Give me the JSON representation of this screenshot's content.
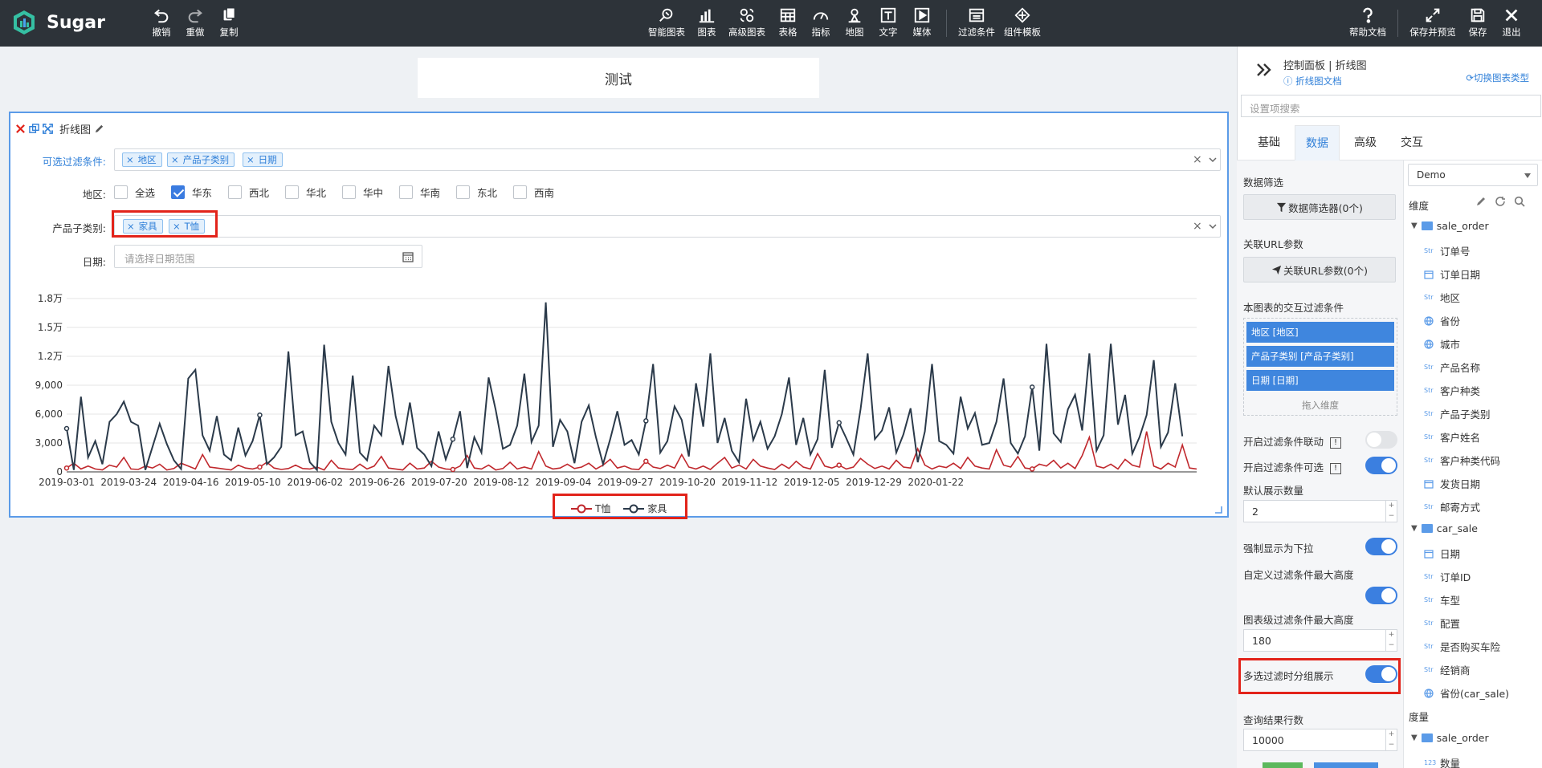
{
  "app": {
    "name": "Sugar"
  },
  "toolbar_left": [
    {
      "id": "undo",
      "label": "撤销",
      "icon": "undo-icon"
    },
    {
      "id": "redo",
      "label": "重做",
      "icon": "redo-icon"
    },
    {
      "id": "copy",
      "label": "复制",
      "icon": "copy-icon"
    }
  ],
  "toolbar_center": [
    {
      "id": "smart-chart",
      "label": "智能图表",
      "icon": "magic-icon"
    },
    {
      "id": "chart",
      "label": "图表",
      "icon": "bar-chart-icon"
    },
    {
      "id": "advanced-chart",
      "label": "高级图表",
      "icon": "advanced-chart-icon"
    },
    {
      "id": "table",
      "label": "表格",
      "icon": "table-icon"
    },
    {
      "id": "metric",
      "label": "指标",
      "icon": "gauge-icon"
    },
    {
      "id": "map",
      "label": "地图",
      "icon": "map-pin-icon"
    },
    {
      "id": "text",
      "label": "文字",
      "icon": "text-icon"
    },
    {
      "id": "media",
      "label": "媒体",
      "icon": "play-icon"
    },
    {
      "id": "filter",
      "label": "过滤条件",
      "icon": "filter-icon"
    },
    {
      "id": "template",
      "label": "组件模板",
      "icon": "template-icon"
    }
  ],
  "toolbar_right": [
    {
      "id": "help",
      "label": "帮助文档",
      "icon": "question-icon"
    },
    {
      "id": "save-preview",
      "label": "保存并预览",
      "icon": "expand-icon"
    },
    {
      "id": "save",
      "label": "保存",
      "icon": "save-icon"
    },
    {
      "id": "exit",
      "label": "退出",
      "icon": "close-icon"
    }
  ],
  "canvas": {
    "title": "测试"
  },
  "chart_card": {
    "title": "折线图",
    "optional_filters_label": "可选过滤条件:",
    "optional_filter_tags": [
      "地区",
      "产品子类别",
      "日期"
    ],
    "region_label": "地区:",
    "region_options": [
      {
        "label": "全选",
        "checked": false
      },
      {
        "label": "华东",
        "checked": true
      },
      {
        "label": "西北",
        "checked": false
      },
      {
        "label": "华北",
        "checked": false
      },
      {
        "label": "华中",
        "checked": false
      },
      {
        "label": "华南",
        "checked": false
      },
      {
        "label": "东北",
        "checked": false
      },
      {
        "label": "西南",
        "checked": false
      }
    ],
    "subcategory_label": "产品子类别:",
    "subcategory_tags": [
      "家具",
      "T恤"
    ],
    "date_label": "日期:",
    "date_placeholder": "请选择日期范围"
  },
  "chart_data": {
    "type": "line",
    "ylim": [
      0,
      18000
    ],
    "y_ticks": [
      0,
      3000,
      6000,
      9000,
      12000,
      15000,
      18000
    ],
    "y_tick_labels": [
      "0",
      "3,000",
      "6,000",
      "9,000",
      "1.2万",
      "1.5万",
      "1.8万"
    ],
    "x_tick_labels": [
      "2019-03-01",
      "2019-03-24",
      "2019-04-16",
      "2019-05-10",
      "2019-06-02",
      "2019-06-26",
      "2019-07-20",
      "2019-08-12",
      "2019-09-04",
      "2019-09-27",
      "2019-10-20",
      "2019-11-12",
      "2019-12-05",
      "2019-12-29",
      "2020-01-22"
    ],
    "grid": true,
    "legend_position": "bottom-center",
    "series": [
      {
        "name": "T恤",
        "color": "#c0282d",
        "values": [
          400,
          900,
          300,
          600,
          300,
          200,
          700,
          500,
          1500,
          300,
          250,
          600,
          400,
          800,
          200,
          350,
          900,
          600,
          300,
          1800,
          500,
          400,
          300,
          200,
          700,
          400,
          300,
          500,
          1000,
          400,
          250,
          350,
          700,
          350,
          300,
          500,
          200,
          1200,
          400,
          300,
          250,
          800,
          300,
          600,
          1600,
          400,
          300,
          200,
          900,
          300,
          400,
          1100,
          500,
          300,
          250,
          600,
          1700,
          400,
          300,
          700,
          200,
          350,
          1000,
          300,
          500,
          300,
          2100,
          600,
          300,
          400,
          800,
          350,
          500,
          900,
          300,
          700,
          1300,
          400,
          600,
          300,
          250,
          1100,
          500,
          350,
          700,
          400,
          1800,
          500,
          300,
          600,
          250,
          900,
          1500,
          400,
          700,
          300,
          1300,
          600,
          400,
          250,
          800,
          350,
          1100,
          500,
          300,
          1900,
          600,
          400,
          700,
          300,
          500,
          1400,
          800,
          350,
          600,
          300,
          1200,
          500,
          400,
          2400,
          700,
          300,
          600,
          450,
          900,
          350,
          1500,
          600,
          400,
          300,
          2300,
          700,
          500,
          1600,
          400,
          300,
          800,
          600,
          1200,
          400,
          900,
          350,
          1700,
          3600,
          600,
          400,
          800,
          300,
          1300,
          700,
          500,
          4200,
          600,
          300,
          900,
          500,
          2800,
          400,
          300
        ]
      },
      {
        "name": "家具",
        "color": "#2b3a4a",
        "values": [
          4500,
          200,
          7800,
          1500,
          3200,
          800,
          5200,
          6000,
          7300,
          5200,
          4800,
          200,
          2600,
          5000,
          2900,
          1200,
          300,
          9700,
          10600,
          3800,
          2200,
          5800,
          1800,
          1200,
          4600,
          1700,
          3200,
          5900,
          800,
          1500,
          2600,
          12500,
          3800,
          4200,
          1000,
          200,
          13200,
          5200,
          3000,
          1800,
          10000,
          2000,
          1200,
          4800,
          3800,
          11000,
          5800,
          2800,
          7200,
          2500,
          1800,
          600,
          4200,
          1300,
          3400,
          6300,
          400,
          3600,
          2000,
          9800,
          6400,
          2400,
          2800,
          4800,
          10200,
          3100,
          4800,
          17600,
          2600,
          5400,
          4200,
          900,
          5200,
          6900,
          3600,
          800,
          3400,
          6300,
          2800,
          3300,
          1800,
          5300,
          11200,
          2000,
          3200,
          6800,
          5400,
          1600,
          9200,
          4700,
          12300,
          3000,
          5600,
          2200,
          1000,
          7600,
          3300,
          5200,
          2400,
          3700,
          6000,
          9800,
          2800,
          5600,
          1800,
          3400,
          10600,
          2500,
          5100,
          3500,
          1800,
          6500,
          12300,
          3400,
          4300,
          6700,
          2000,
          3900,
          6600,
          1000,
          4200,
          11200,
          3200,
          2800,
          1900,
          7800,
          4500,
          6100,
          2800,
          3000,
          5200,
          9700,
          3000,
          1900,
          3700,
          8800,
          2200,
          13300,
          4000,
          3100,
          6500,
          8000,
          4300,
          12300,
          2200,
          3800,
          13300,
          4900,
          8000,
          1900,
          3600,
          5900,
          11600,
          2600,
          4100,
          9200,
          3700
        ]
      }
    ]
  },
  "panel": {
    "title": "控制面板 | 折线图",
    "doc_link": "折线图文档",
    "switch_link": "切换图表类型",
    "search_placeholder": "设置项搜索",
    "tabs": [
      "基础",
      "数据",
      "高级",
      "交互"
    ],
    "active_tab": "数据",
    "settings": {
      "data_filter_label": "数据筛选",
      "data_filter_button": "数据筛选器(0个)",
      "url_param_label": "关联URL参数",
      "url_param_button": "关联URL参数(0个)",
      "interactive_filters_label": "本图表的交互过滤条件",
      "interactive_filters": [
        "地区 [地区]",
        "产品子类别 [产品子类别]",
        "日期 [日期]"
      ],
      "drop_hint": "拖入维度",
      "filter_linkage_label": "开启过滤条件联动",
      "filter_optional_label": "开启过滤条件可选",
      "default_count_label": "默认展示数量",
      "default_count_value": "2",
      "force_dropdown_label": "强制显示为下拉",
      "custom_max_height_label": "自定义过滤条件最大高度",
      "chart_filter_max_height_label": "图表级过滤条件最大高度",
      "chart_filter_max_height_value": "180",
      "multi_group_label": "多选过滤时分组展示",
      "query_rows_label": "查询结果行数",
      "query_rows_value": "10000"
    },
    "fields": {
      "source": "Demo",
      "dimension_label": "维度",
      "measure_label": "度量",
      "sale_order_table": "sale_order",
      "sale_order_fields": [
        {
          "name": "订单号",
          "type": "str"
        },
        {
          "name": "订单日期",
          "type": "date"
        },
        {
          "name": "地区",
          "type": "str"
        },
        {
          "name": "省份",
          "type": "geo"
        },
        {
          "name": "城市",
          "type": "geo"
        },
        {
          "name": "产品名称",
          "type": "str"
        },
        {
          "name": "客户种类",
          "type": "str"
        },
        {
          "name": "产品子类别",
          "type": "str"
        },
        {
          "name": "客户姓名",
          "type": "str"
        },
        {
          "name": "客户种类代码",
          "type": "str"
        },
        {
          "name": "发货日期",
          "type": "date"
        },
        {
          "name": "邮寄方式",
          "type": "str"
        }
      ],
      "car_sale_table": "car_sale",
      "car_sale_fields": [
        {
          "name": "日期",
          "type": "date"
        },
        {
          "name": "订单ID",
          "type": "str"
        },
        {
          "name": "车型",
          "type": "str"
        },
        {
          "name": "配置",
          "type": "str"
        },
        {
          "name": "是否购买车险",
          "type": "str"
        },
        {
          "name": "经销商",
          "type": "str"
        },
        {
          "name": "省份(car_sale)",
          "type": "geo"
        }
      ],
      "measure_table": "sale_order",
      "measure_fields": [
        {
          "name": "数量",
          "type": "num"
        }
      ],
      "type_badges": {
        "str": "Str",
        "num": "123"
      }
    }
  }
}
